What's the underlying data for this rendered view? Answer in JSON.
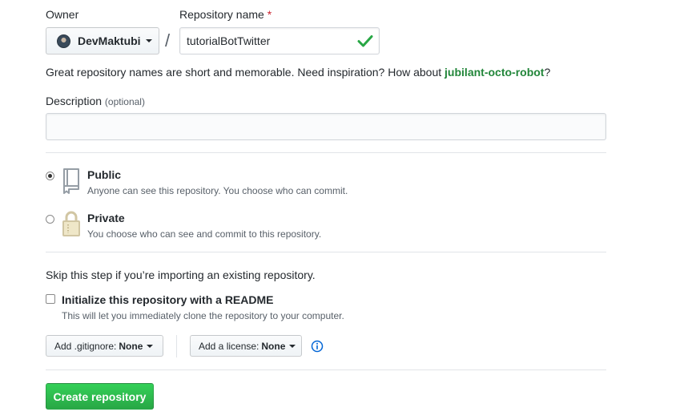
{
  "owner": {
    "label": "Owner",
    "username": "DevMaktubi"
  },
  "repo": {
    "label": "Repository name",
    "required_mark": "*",
    "value": "tutorialBotTwitter",
    "separator": "/"
  },
  "hint": {
    "text": "Great repository names are short and memorable. Need inspiration? How about",
    "suggestion": "jubilant-octo-robot",
    "suffix": "?"
  },
  "description": {
    "label": "Description",
    "optional": "(optional)",
    "value": ""
  },
  "visibility": {
    "public": {
      "title": "Public",
      "subtitle": "Anyone can see this repository. You choose who can commit.",
      "selected": true
    },
    "private": {
      "title": "Private",
      "subtitle": "You choose who can see and commit to this repository.",
      "selected": false
    }
  },
  "import_note": "Skip this step if you’re importing an existing repository.",
  "readme": {
    "label": "Initialize this repository with a README",
    "subtitle": "This will let you immediately clone the repository to your computer.",
    "checked": false
  },
  "gitignore": {
    "label": "Add .gitignore:",
    "value": "None"
  },
  "license": {
    "label": "Add a license:",
    "value": "None"
  },
  "submit_label": "Create repository",
  "colors": {
    "accent_green": "#28a745",
    "link_green": "#22863a",
    "info_blue": "#0366d6",
    "required_red": "#cb2431"
  }
}
